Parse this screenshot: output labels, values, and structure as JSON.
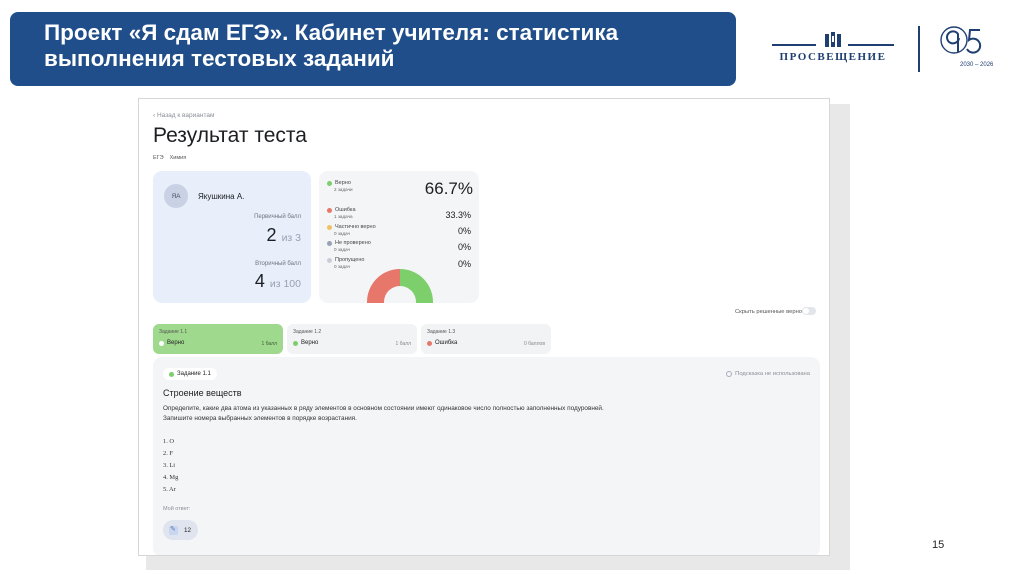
{
  "slide": {
    "title_line1": "Проект «Я сдам ЕГЭ». Кабинет учителя: статистика",
    "title_line2": "выполнения тестовых заданий",
    "page_number": "15"
  },
  "logo": {
    "brand": "ПРОСВЕЩЕНИЕ",
    "years": "2030 – 2026",
    "colors": {
      "primary": "#1f3f73"
    }
  },
  "screen": {
    "back_link": "‹ Назад к вариантам",
    "title": "Результат теста",
    "tags": [
      "ЕГЭ",
      "Химия"
    ],
    "student": {
      "initials": "ЯА",
      "name": "Якушкина А.",
      "primary_label": "Первичный балл",
      "primary_value": "2",
      "primary_of": "из 3",
      "secondary_label": "Вторичный балл",
      "secondary_value": "4",
      "secondary_of": "из 100"
    },
    "results": {
      "correct": {
        "label": "Верно",
        "sub": "2 задачи",
        "percent": "66.7%",
        "color": "#7dcf6b"
      },
      "error": {
        "label": "Ошибка",
        "sub": "1 задача",
        "percent": "33.3%",
        "color": "#e8776b"
      },
      "partial": {
        "label": "Частично верно",
        "sub": "0 задач",
        "percent": "0%",
        "color": "#f2c163"
      },
      "unchecked": {
        "label": "Не проверено",
        "sub": "0 задач",
        "percent": "0%",
        "color": "#98a2b3"
      },
      "skipped": {
        "label": "Пропущено",
        "sub": "0 задач",
        "percent": "0%",
        "color": "#c9ced6"
      }
    },
    "toggle_label": "Скрыть решенные верно",
    "task_tabs": [
      {
        "header": "Задание 1.1",
        "status": "Верно",
        "points": "1 балл",
        "color": "#ffffff"
      },
      {
        "header": "Задание 1.2",
        "status": "Верно",
        "points": "1 балл",
        "color": "#7dcf6b"
      },
      {
        "header": "Задание 1.3",
        "status": "Ошибка",
        "points": "0 баллов",
        "color": "#e8776b"
      }
    ],
    "task": {
      "badge": "Задание 1.1",
      "hint": "Подсказка не использована",
      "title": "Строение веществ",
      "text_line1": "Определите, какие два атома из указанных в ряду элементов в основном состоянии имеют одинаковое число полностью заполненных подуровней.",
      "text_line2": "Запишите номера выбранных элементов в порядке возрастания.",
      "options": [
        "1. O",
        "2. F",
        "3. Li",
        "4. Mg",
        "5. Ar"
      ],
      "answer_label": "Мой ответ:",
      "answer_value": "12"
    }
  }
}
